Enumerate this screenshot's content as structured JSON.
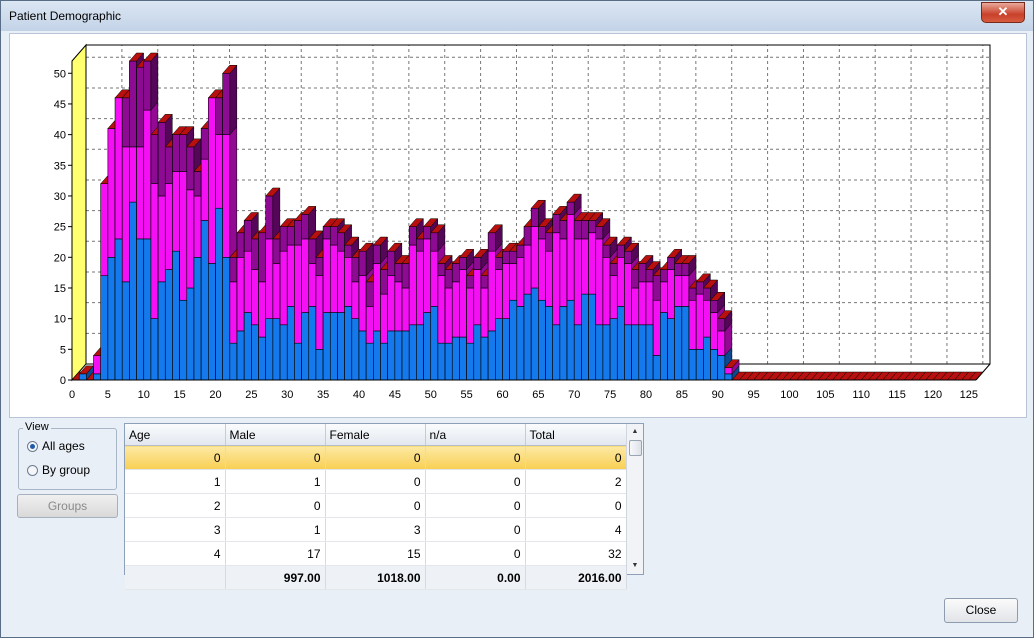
{
  "window": {
    "title": "Patient Demographic"
  },
  "colors": {
    "male": "#1479ec",
    "female": "#f50ff5",
    "na": "#8d0a92",
    "empty": "#b80f0f",
    "axis_wall": "#ffff70"
  },
  "chart_data": {
    "type": "bar",
    "stacked": true,
    "three_d": true,
    "grid": true,
    "x_ticks": [
      "0",
      "5",
      "10",
      "15",
      "20",
      "25",
      "30",
      "35",
      "40",
      "45",
      "50",
      "55",
      "60",
      "65",
      "70",
      "75",
      "80",
      "85",
      "90",
      "95",
      "100",
      "105",
      "110",
      "115",
      "120",
      "125"
    ],
    "y_ticks": [
      "0",
      "5",
      "10",
      "15",
      "20",
      "25",
      "30",
      "35",
      "40",
      "45",
      "50"
    ],
    "xlim": [
      0,
      126
    ],
    "ylim": [
      0,
      52
    ],
    "categories": [
      0,
      1,
      2,
      3,
      4,
      5,
      6,
      7,
      8,
      9,
      10,
      11,
      12,
      13,
      14,
      15,
      16,
      17,
      18,
      19,
      20,
      21,
      22,
      23,
      24,
      25,
      26,
      27,
      28,
      29,
      30,
      31,
      32,
      33,
      34,
      35,
      36,
      37,
      38,
      39,
      40,
      41,
      42,
      43,
      44,
      45,
      46,
      47,
      48,
      49,
      50,
      51,
      52,
      53,
      54,
      55,
      56,
      57,
      58,
      59,
      60,
      61,
      62,
      63,
      64,
      65,
      66,
      67,
      68,
      69,
      70,
      71,
      72,
      73,
      74,
      75,
      76,
      77,
      78,
      79,
      80,
      81,
      82,
      83,
      84,
      85,
      86,
      87,
      88,
      89,
      90,
      91,
      92,
      93,
      94,
      95,
      96,
      97,
      98,
      99,
      100,
      101,
      102,
      103,
      104,
      105,
      106,
      107,
      108,
      109,
      110,
      111,
      112,
      113,
      114,
      115,
      116,
      117,
      118,
      119,
      120,
      121,
      122,
      123,
      124,
      125
    ],
    "series": [
      {
        "name": "Male",
        "values": [
          0,
          1,
          0,
          1,
          17,
          20,
          23,
          16,
          29,
          23,
          23,
          10,
          16,
          18,
          21,
          13,
          15,
          20,
          26,
          19,
          28,
          20,
          6,
          8,
          11,
          9,
          7,
          10,
          10,
          9,
          12,
          6,
          11,
          12,
          5,
          11,
          11,
          11,
          12,
          10,
          8,
          6,
          8,
          6,
          8,
          8,
          8,
          9,
          9,
          11,
          12,
          6,
          6,
          7,
          7,
          6,
          9,
          7,
          8,
          10,
          10,
          13,
          12,
          14,
          15,
          13,
          12,
          9,
          12,
          13,
          9,
          14,
          14,
          9,
          9,
          10,
          12,
          9,
          9,
          9,
          9,
          4,
          11,
          10,
          12,
          12,
          5,
          5,
          7,
          5,
          4,
          1,
          0,
          0,
          0,
          0,
          0,
          0,
          0,
          0,
          0,
          0,
          0,
          0,
          0,
          0,
          0,
          0,
          0,
          0,
          0,
          0,
          0,
          0,
          0,
          0,
          0,
          0,
          0,
          0,
          0,
          0,
          0,
          0,
          0,
          0,
          0
        ]
      },
      {
        "name": "Female",
        "values": [
          0,
          0,
          0,
          3,
          15,
          21,
          23,
          22,
          9,
          15,
          21,
          22,
          14,
          14,
          13,
          21,
          16,
          10,
          10,
          27,
          12,
          20,
          10,
          12,
          10,
          9,
          9,
          13,
          9,
          12,
          10,
          16,
          12,
          7,
          12,
          12,
          11,
          10,
          8,
          6,
          9,
          6,
          11,
          8,
          9,
          8,
          7,
          13,
          12,
          12,
          9,
          11,
          9,
          9,
          11,
          9,
          9,
          8,
          13,
          8,
          9,
          6,
          8,
          8,
          10,
          10,
          9,
          15,
          11,
          14,
          14,
          9,
          10,
          14,
          11,
          7,
          8,
          10,
          6,
          7,
          7,
          9,
          5,
          8,
          5,
          5,
          8,
          9,
          6,
          6,
          4,
          1,
          0,
          0,
          0,
          0,
          0,
          0,
          0,
          0,
          0,
          0,
          0,
          0,
          0,
          0,
          0,
          0,
          0,
          0,
          0,
          0,
          0,
          0,
          0,
          0,
          0,
          0,
          0,
          0,
          0,
          0,
          0,
          0,
          0,
          0,
          0
        ]
      },
      {
        "name": "n/a",
        "values": [
          0,
          0,
          0,
          0,
          0,
          0,
          0,
          8,
          14,
          13,
          8,
          8,
          12,
          6,
          6,
          6,
          7,
          4,
          5,
          0,
          6,
          10,
          4,
          4,
          5,
          5,
          8,
          7,
          4,
          4,
          3,
          4,
          4,
          4,
          3,
          2,
          3,
          3,
          2,
          4,
          4,
          4,
          3,
          4,
          4,
          3,
          4,
          3,
          2,
          2,
          3,
          2,
          3,
          3,
          2,
          2,
          2,
          2,
          3,
          2,
          2,
          2,
          2,
          3,
          3,
          2,
          3,
          3,
          3,
          2,
          3,
          3,
          2,
          2,
          2,
          2,
          2,
          2,
          3,
          3,
          2,
          4,
          2,
          2,
          2,
          2,
          2,
          2,
          2,
          2,
          2,
          0,
          0,
          0,
          0,
          0,
          0,
          0,
          0,
          0,
          0,
          0,
          0,
          0,
          0,
          0,
          0,
          0,
          0,
          0,
          0,
          0,
          0,
          0,
          0,
          0,
          0,
          0,
          0,
          0,
          0,
          0,
          0,
          0,
          0,
          0,
          0
        ]
      }
    ]
  },
  "view": {
    "legend": "View",
    "options": [
      {
        "label": "All ages",
        "selected": true
      },
      {
        "label": "By group",
        "selected": false
      }
    ],
    "groups_button": "Groups"
  },
  "table": {
    "columns": [
      "Age",
      "Male",
      "Female",
      "n/a",
      "Total"
    ],
    "rows": [
      [
        "0",
        "0",
        "0",
        "0",
        "0"
      ],
      [
        "1",
        "1",
        "0",
        "0",
        "2"
      ],
      [
        "2",
        "0",
        "0",
        "0",
        "0"
      ],
      [
        "3",
        "1",
        "3",
        "0",
        "4"
      ],
      [
        "4",
        "17",
        "15",
        "0",
        "32"
      ]
    ],
    "totals": [
      "",
      "997.00",
      "1018.00",
      "0.00",
      "2016.00"
    ]
  },
  "close_button": "Close"
}
